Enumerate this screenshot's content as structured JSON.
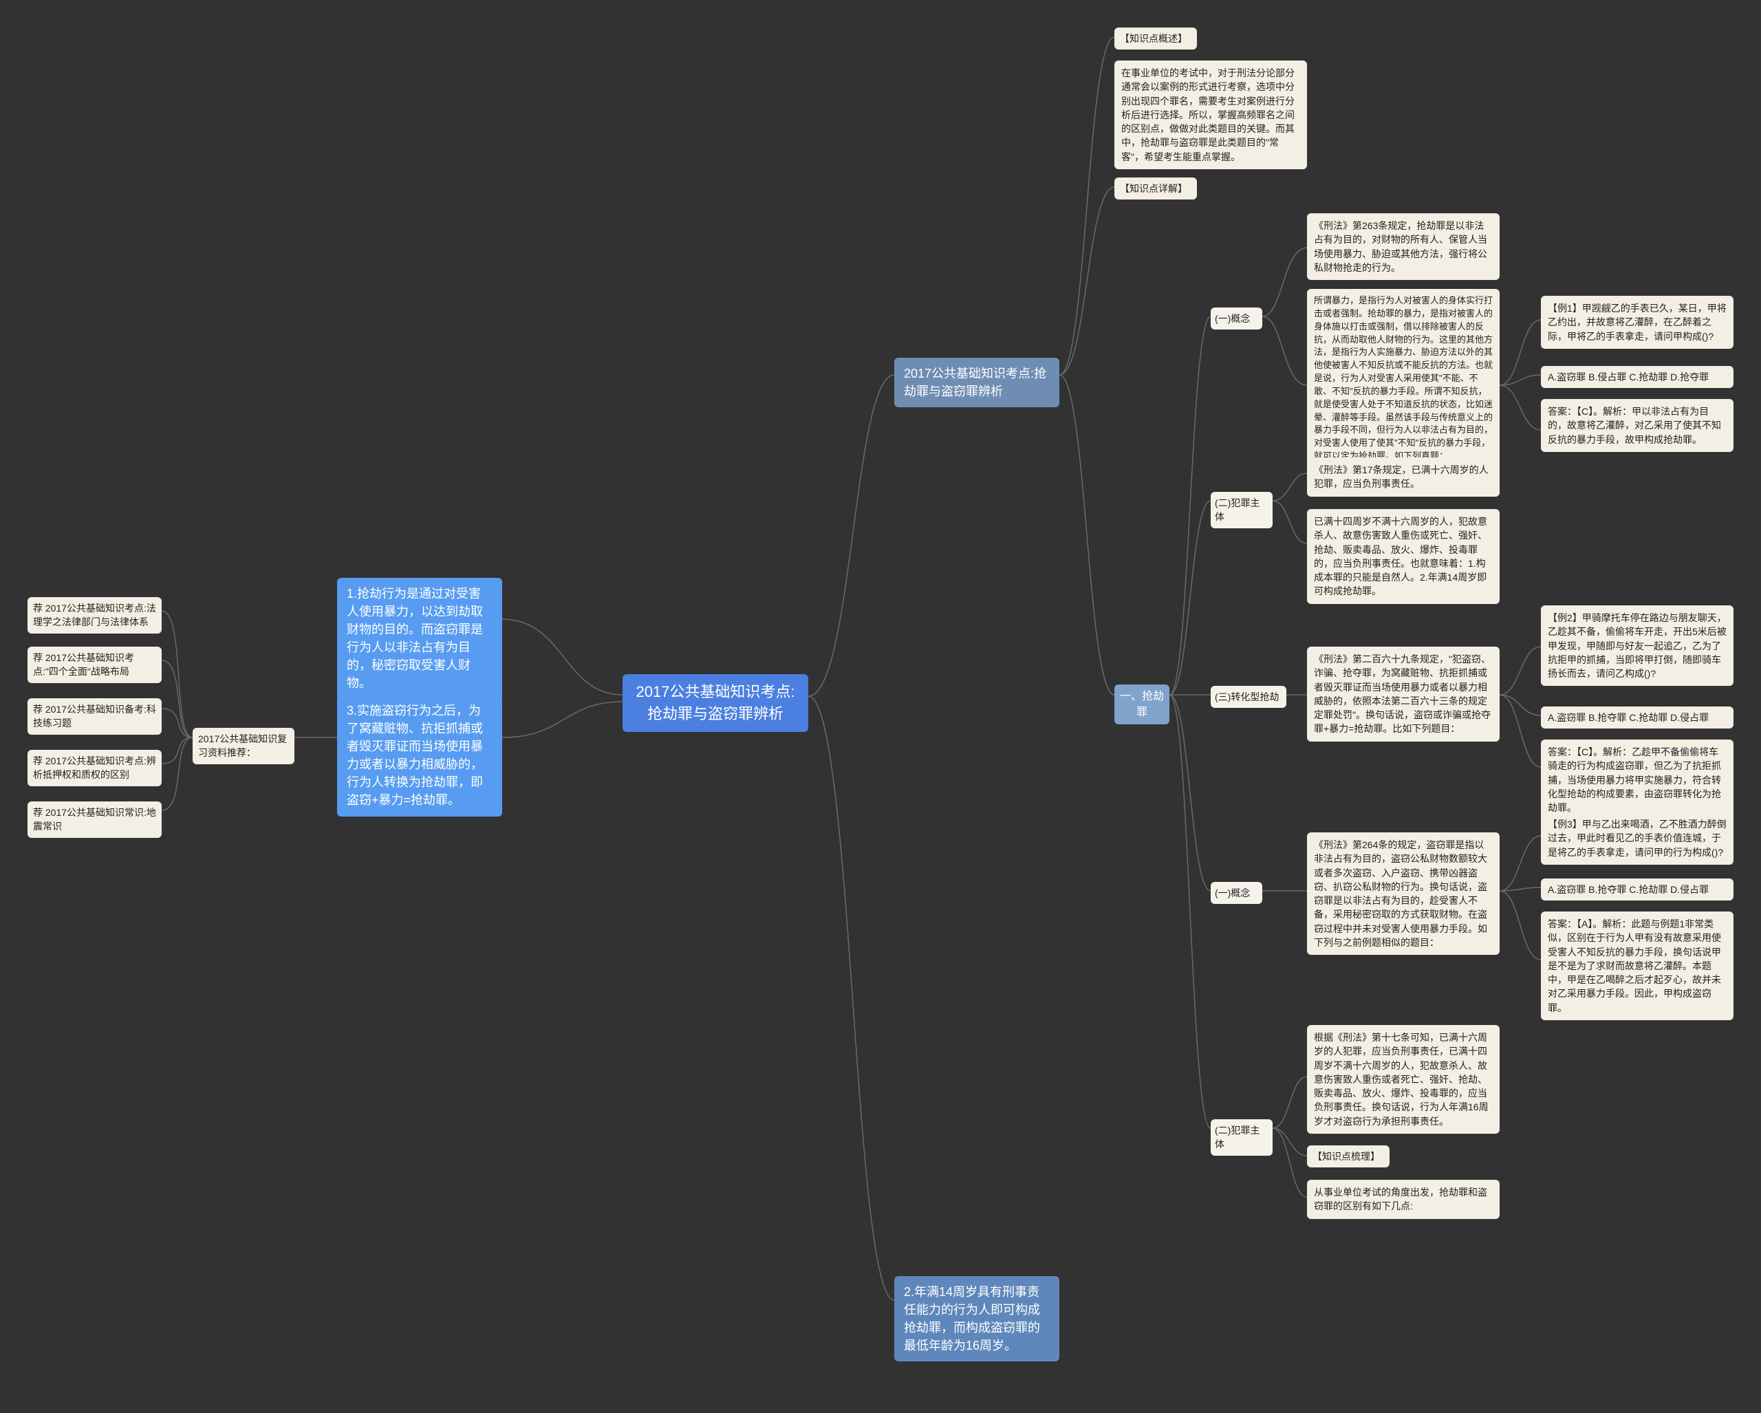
{
  "root": {
    "title": "2017公共基础知识考点:抢劫罪与盗窃罪辨析"
  },
  "left_intermediates": {
    "p1": "1.抢劫行为是通过对受害人使用暴力，以达到劫取财物的目的。而盗窃罪是行为人以非法占有为目的，秘密窃取受害人财物。",
    "p3": "3.实施盗窃行为之后，为了窝藏赃物、抗拒抓捕或者毁灭罪证而当场使用暴力或者以暴力相威胁的，行为人转换为抢劫罪，即盗窃+暴力=抢劫罪。",
    "resources_label": "2017公共基础知识复习资料推荐：",
    "resources": {
      "r0": "荐 2017公共基础知识考点:法理学之法律部门与法律体系",
      "r1": "荐 2017公共基础知识考点:\"四个全面\"战略布局",
      "r2": "荐 2017公共基础知识备考:科技练习题",
      "r3": "荐 2017公共基础知识考点:辨析抵押权和质权的区别",
      "r4": "荐 2017公共基础知识常识:地震常识"
    }
  },
  "right": {
    "title": "2017公共基础知识考点:抢劫罪与盗窃罪辨析",
    "kp_overview_tag": "【知识点概述】",
    "kp_overview_body": "在事业单位的考试中，对于刑法分论部分通常会以案例的形式进行考察，选项中分别出现四个罪名，需要考生对案例进行分析后进行选择。所以，掌握高频罪名之间的区别点，做做对此类题目的关键。而其中，抢劫罪与盗窃罪是此类题目的\"常客\"，希望考生能重点掌握。",
    "kp_detail_tag": "【知识点详解】",
    "sec1": {
      "label": "一、抢劫罪",
      "a": {
        "label": "(一)概念",
        "law": "《刑法》第263条规定，抢劫罪是以非法占有为目的，对财物的所有人、保管人当场使用暴力、胁迫或其他方法，强行将公私财物抢走的行为。",
        "body": "所谓暴力，是指行为人对被害人的身体实行打击或者强制。抢劫罪的暴力，是指对被害人的身体施以打击或强制，借以排除被害人的反抗，从而劫取他人财物的行为。这里的其他方法，是指行为人实施暴力、胁迫方法以外的其他使被害人不知反抗或不能反抗的方法。也就是说，行为人对受害人采用使其\"不能、不敢、不知\"反抗的暴力手段。所谓不知反抗，就是使受害人处于不知道反抗的状态，比如迷晕、灌醉等手段。虽然该手段与传统意义上的暴力手段不同，但行为人以非法占有为目的，对受害人使用了使其\"不知\"反抗的暴力手段，就可以定为抢劫罪。如下列真题：",
        "ex1": "【例1】甲觊觎乙的手表已久，某日，甲将乙约出，并故意将乙灌醉，在乙醉着之际，甲将乙的手表拿走，请问甲构成()?",
        "opts": "A.盗窃罪 B.侵占罪 C.抢劫罪 D.抢夺罪",
        "ans": "答案：【C】。解析：甲以非法占有为目的，故意将乙灌醉，对乙采用了使其不知反抗的暴力手段，故甲构成抢劫罪。"
      },
      "b": {
        "label": "(二)犯罪主体",
        "law": "《刑法》第17条规定，已满十六周岁的人犯罪，应当负刑事责任。",
        "body": "已满十四周岁不满十六周岁的人，犯故意杀人、故意伤害致人重伤或死亡、强奸、抢劫、贩卖毒品、放火、爆炸、投毒罪的，应当负刑事责任。也就意味着：1.构成本罪的只能是自然人。2.年满14周岁即可构成抢劫罪。"
      },
      "c": {
        "label": "(三)转化型抢劫",
        "law": "《刑法》第二百六十九条规定，\"犯盗窃、诈骗、抢夺罪，为窝藏赃物、抗拒抓捕或者毁灭罪证而当场使用暴力或者以暴力相威胁的，依照本法第二百六十三条的规定定罪处罚\"。换句话说，盗窃或诈骗或抢夺罪+暴力=抢劫罪。比如下列题目：",
        "ex2": "【例2】甲骑摩托车停在路边与朋友聊天，乙趁其不备，偷偷将车开走，开出5米后被甲发现，甲随即与好友一起追乙，乙为了抗拒甲的抓捕，当即将甲打倒，随即骑车扬长而去，请问乙构成()?",
        "opts": "A.盗窃罪 B.抢夺罪 C.抢劫罪 D.侵占罪",
        "ans": "答案：【C】。解析：乙趁甲不备偷偷将车骑走的行为构成盗窃罪，但乙为了抗拒抓捕，当场使用暴力将甲实施暴力，符合转化型抢劫的构成要素，由盗窃罪转化为抢劫罪。"
      }
    },
    "sec2": {
      "a": {
        "label": "(一)概念",
        "law": "《刑法》第264条的规定，盗窃罪是指以非法占有为目的，盗窃公私财物数额较大或者多次盗窃、入户盗窃、携带凶器盗窃、扒窃公私财物的行为。换句话说，盗窃罪是以非法占有为目的，趁受害人不备，采用秘密窃取的方式获取财物。在盗窃过程中并未对受害人使用暴力手段。如下列与之前例题相似的题目：",
        "ex3": "【例3】甲与乙出来喝酒，乙不胜酒力醉倒过去，甲此时看见乙的手表价值连城，于是将乙的手表拿走，请问甲的行为构成()?",
        "opts": "A.盗窃罪 B.抢夺罪 C.抢劫罪 D.侵占罪",
        "ans": "答案：【A】。解析：此题与例题1非常类似，区别在于行为人甲有没有故意采用使受害人不知反抗的暴力手段，换句话说甲是不是为了求财而故意将乙灌醉。本题中，甲是在乙喝醉之后才起歹心，故并未对乙采用暴力手段。因此，甲构成盗窃罪。"
      },
      "b": {
        "label": "(二)犯罪主体",
        "law": "根据《刑法》第十七条可知，已满十六周岁的人犯罪，应当负刑事责任，已满十四周岁不满十六周岁的人，犯故意杀人、故意伤害致人重伤或者死亡、强奸、抢劫、贩卖毒品、放火、爆炸、投毒罪的，应当负刑事责任。换句话说，行为人年满16周岁才对盗窃行为承担刑事责任。",
        "tidy_tag": "【知识点梳理】",
        "tidy_body": "从事业单位考试的角度出发，抢劫罪和盗窃罪的区别有如下几点:"
      }
    },
    "p2": "2.年满14周岁具有刑事责任能力的行为人即可构成抢劫罪，而构成盗窃罪的最低年龄为16周岁。"
  },
  "chart_data": {
    "type": "mindmap",
    "root": "2017公共基础知识考点:抢劫罪与盗窃罪辨析",
    "children": [
      {
        "side": "left",
        "label": "1.抢劫行为是通过对受害人使用暴力…秘密窃取受害人财物。"
      },
      {
        "side": "left",
        "label": "3.实施盗窃行为之后…即盗窃+暴力=抢劫罪。",
        "children": [
          {
            "label": "2017公共基础知识复习资料推荐：",
            "children": [
              "荐 2017公共基础知识考点:法理学之法律部门与法律体系",
              "荐 2017公共基础知识考点:\"四个全面\"战略布局",
              "荐 2017公共基础知识备考:科技练习题",
              "荐 2017公共基础知识考点:辨析抵押权和质权的区别",
              "荐 2017公共基础知识常识:地震常识"
            ]
          }
        ]
      },
      {
        "side": "right",
        "label": "2017公共基础知识考点:抢劫罪与盗窃罪辨析",
        "children": [
          {
            "label": "【知识点概述】",
            "children": [
              "在事业单位的考试中…希望考生能重点掌握。"
            ]
          },
          {
            "label": "【知识点详解】",
            "children": [
              {
                "label": "一、抢劫罪",
                "children": [
                  {
                    "label": "(一)概念",
                    "children": [
                      "《刑法》第263条规定…",
                      {
                        "label": "所谓暴力…如下列真题：",
                        "children": [
                          "【例1】…请问甲构成()?",
                          "A.盗窃罪 B.侵占罪 C.抢劫罪 D.抢夺罪",
                          "答案：【C】…故甲构成抢劫罪。"
                        ]
                      }
                    ]
                  },
                  {
                    "label": "(二)犯罪主体",
                    "children": [
                      "《刑法》第17条规定…",
                      "已满十四周岁不满十六周岁的人…2.年满14周岁即可构成抢劫罪。"
                    ]
                  },
                  {
                    "label": "(三)转化型抢劫",
                    "children": [
                      {
                        "label": "《刑法》第二百六十九条规定…比如下列题目：",
                        "children": [
                          "【例2】…请问乙构成()?",
                          "A.盗窃罪 B.抢夺罪 C.抢劫罪 D.侵占罪",
                          "答案：【C】…由盗窃罪转化为抢劫罪。"
                        ]
                      }
                    ]
                  },
                  {
                    "label": "(一)概念",
                    "children": [
                      {
                        "label": "《刑法》第264条的规定…如下列与之前例题相似的题目：",
                        "children": [
                          "【例3】…请问甲的行为构成()?",
                          "A.盗窃罪 B.抢夺罪 C.抢劫罪 D.侵占罪",
                          "答案：【A】…甲构成盗窃罪。"
                        ]
                      }
                    ]
                  },
                  {
                    "label": "(二)犯罪主体",
                    "children": [
                      "根据《刑法》第十七条可知…承担刑事责任。",
                      "【知识点梳理】",
                      "从事业单位考试的角度出发…如下几点:"
                    ]
                  }
                ]
              }
            ]
          },
          "2.年满14周岁具有刑事责任能力的行为人即可构成抢劫罪，而构成盗窃罪的最低年龄为16周岁。"
        ]
      }
    ]
  }
}
